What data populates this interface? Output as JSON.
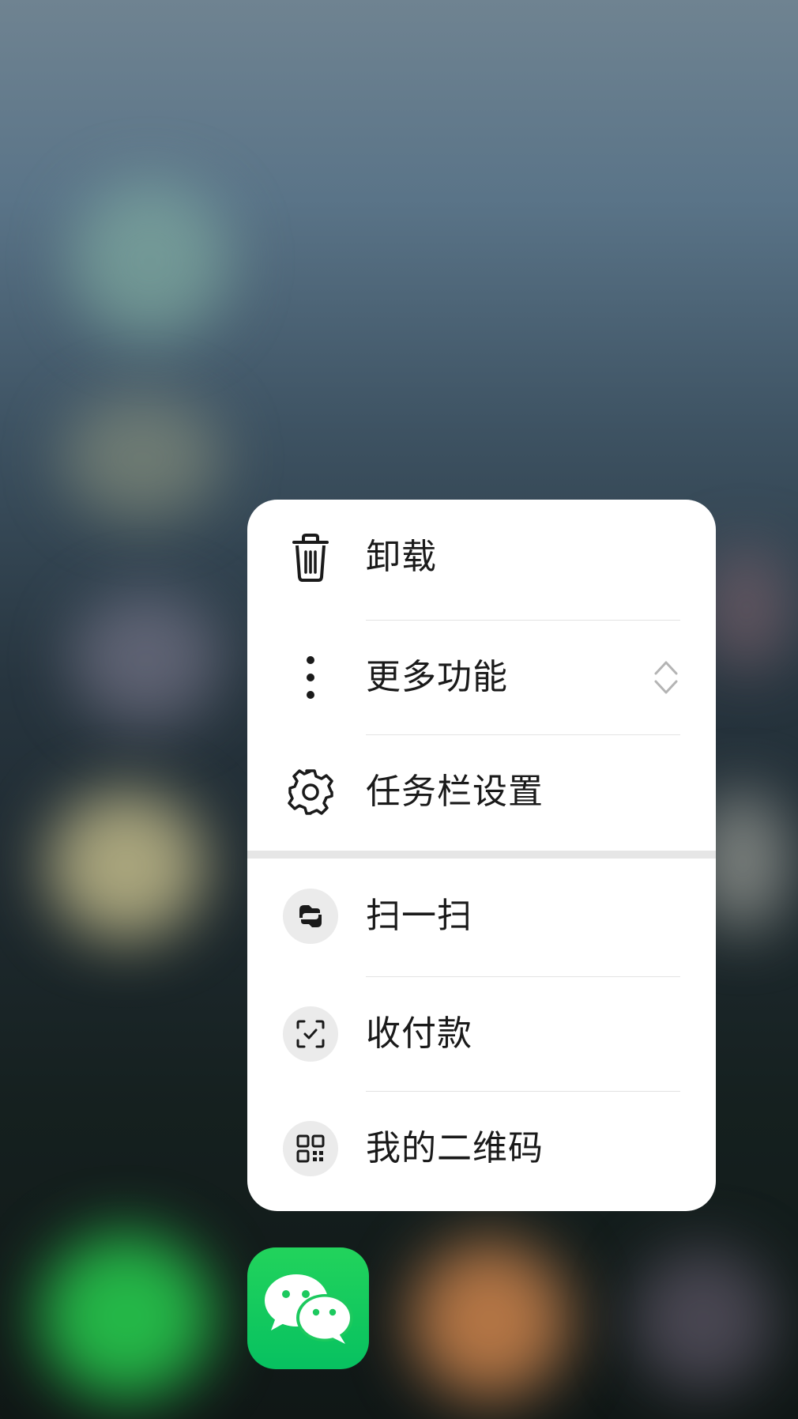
{
  "menu": {
    "items": [
      {
        "label": "卸载",
        "icon": "trash-icon"
      },
      {
        "label": "更多功能",
        "icon": "more-vertical-icon",
        "expand_icon": "expand-chevrons-icon"
      },
      {
        "label": "任务栏设置",
        "icon": "gear-icon"
      }
    ],
    "shortcuts": [
      {
        "label": "扫一扫",
        "icon": "scan-icon"
      },
      {
        "label": "收付款",
        "icon": "payment-icon"
      },
      {
        "label": "我的二维码",
        "icon": "qr-code-icon"
      }
    ]
  },
  "app": {
    "icon": "wechat-icon",
    "accent": "#07c160"
  }
}
